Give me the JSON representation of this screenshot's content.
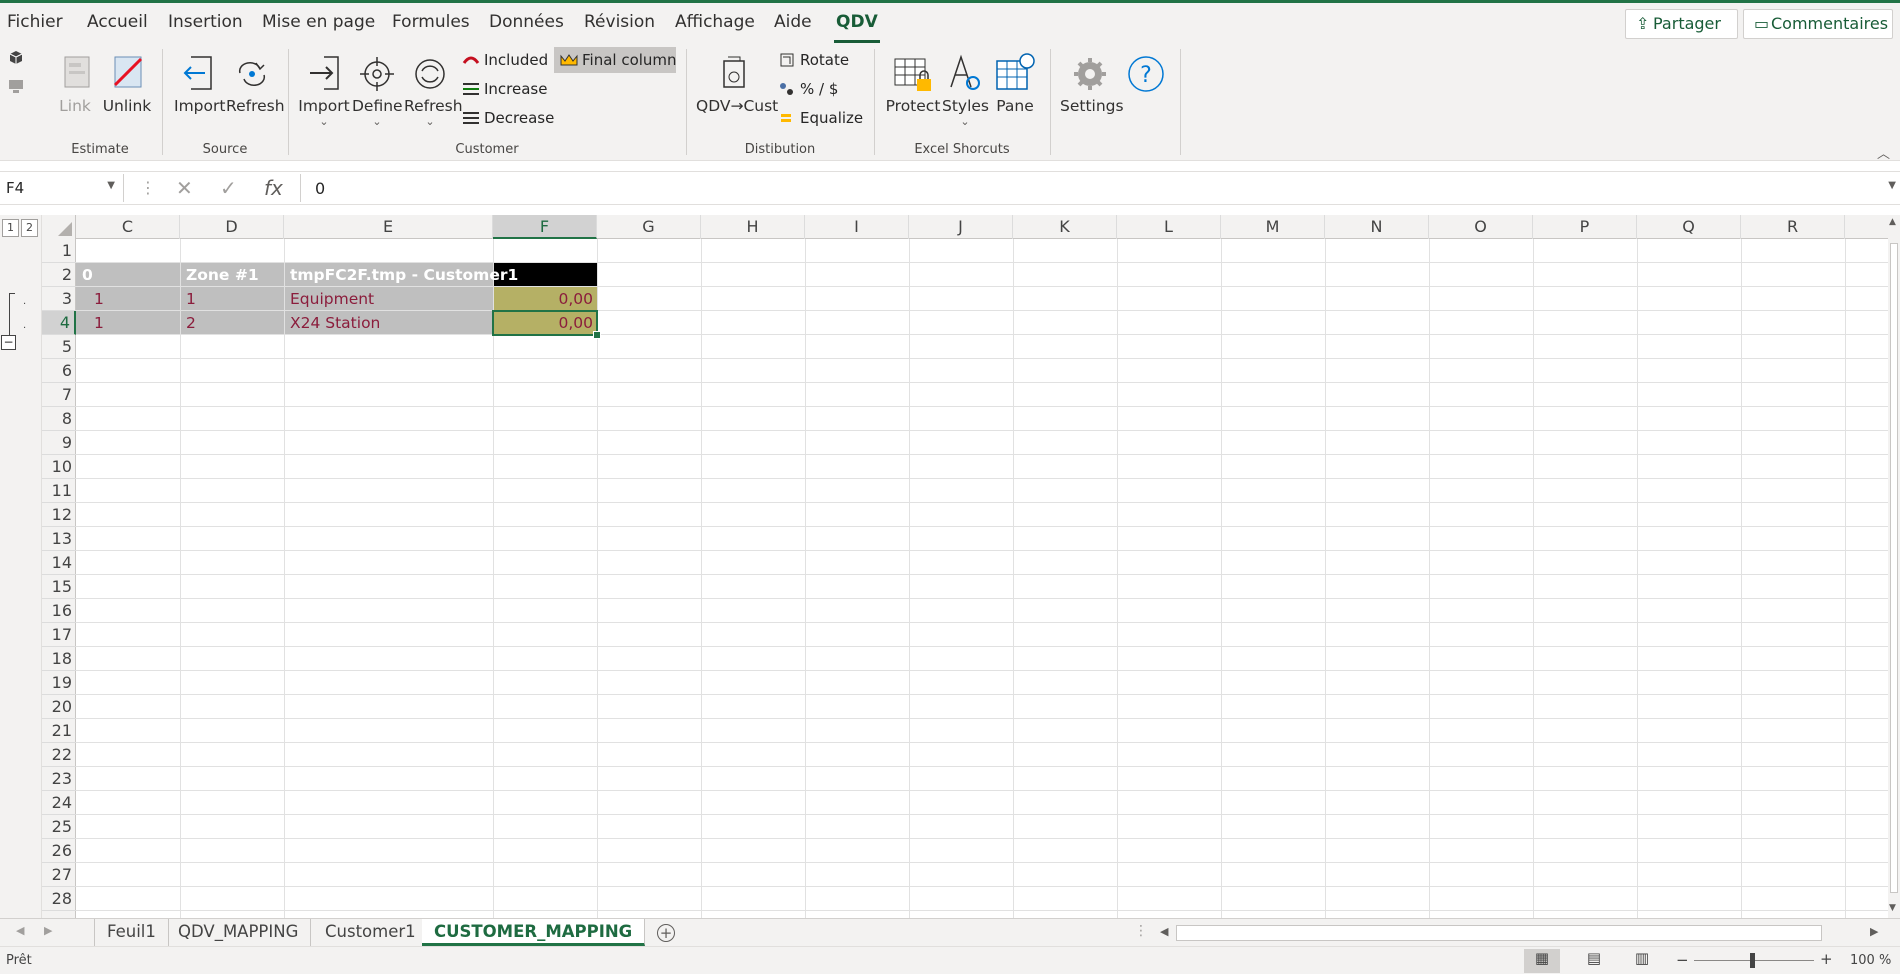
{
  "menu": {
    "tabs": [
      "Fichier",
      "Accueil",
      "Insertion",
      "Mise en page",
      "Formules",
      "Données",
      "Révision",
      "Affichage",
      "Aide",
      "QDV"
    ],
    "active": "QDV",
    "share_label": "Partager",
    "comments_label": "Commentaires"
  },
  "ribbon": {
    "estimate": {
      "label": "Estimate",
      "link": "Link",
      "unlink": "Unlink"
    },
    "source": {
      "label": "Source",
      "import": "Import",
      "refresh": "Refresh"
    },
    "customer": {
      "label": "Customer",
      "import": "Import",
      "define": "Define",
      "refresh": "Refresh",
      "included": "Included",
      "increase": "Increase",
      "decrease": "Decrease",
      "final_column": "Final column"
    },
    "distribution": {
      "label": "Distibution",
      "qdv_cust": "QDV→Cust",
      "rotate": "Rotate",
      "percent": "% / $",
      "equalize": "Equalize"
    },
    "shortcuts": {
      "label": "Excel Shorcuts",
      "protect": "Protect",
      "styles": "Styles",
      "pane": "Pane"
    },
    "settings": "Settings",
    "help_icon": "question-circle-icon"
  },
  "formula_bar": {
    "name_box": "F4",
    "formula": "0"
  },
  "outline_levels": [
    "1",
    "2"
  ],
  "columns": [
    "C",
    "D",
    "E",
    "F",
    "G",
    "H",
    "I",
    "J",
    "K",
    "L",
    "M",
    "N",
    "O",
    "P",
    "Q",
    "R"
  ],
  "selected_column": "F",
  "rows": [
    "1",
    "2",
    "3",
    "4",
    "5",
    "6",
    "7",
    "8",
    "9",
    "10",
    "11",
    "12",
    "13",
    "14",
    "15",
    "16",
    "17",
    "18",
    "19",
    "20",
    "21",
    "22",
    "23",
    "24",
    "25",
    "26",
    "27",
    "28"
  ],
  "selected_row": "4",
  "cells": {
    "row2": {
      "c": "0",
      "d": "Zone #1",
      "e": "tmpFC2F.tmp - Customer1",
      "f": ""
    },
    "row3": {
      "c": "1",
      "d": "1",
      "e": "Equipment",
      "f": "0,00"
    },
    "row4": {
      "c": "1",
      "d": "2",
      "e": "X24 Station",
      "f": "0,00"
    }
  },
  "colors": {
    "accent": "#217346",
    "header_row_bg": "#bfbfbf",
    "row_text": "#8b1d3c",
    "final_col_bg": "#b5b065",
    "final_header_bg": "#000000"
  },
  "sheets": [
    "Feuil1",
    "QDV_MAPPING",
    "Customer1",
    "CUSTOMER_MAPPING"
  ],
  "active_sheet": "CUSTOMER_MAPPING",
  "status": {
    "ready": "Prêt",
    "zoom": "100 %"
  }
}
